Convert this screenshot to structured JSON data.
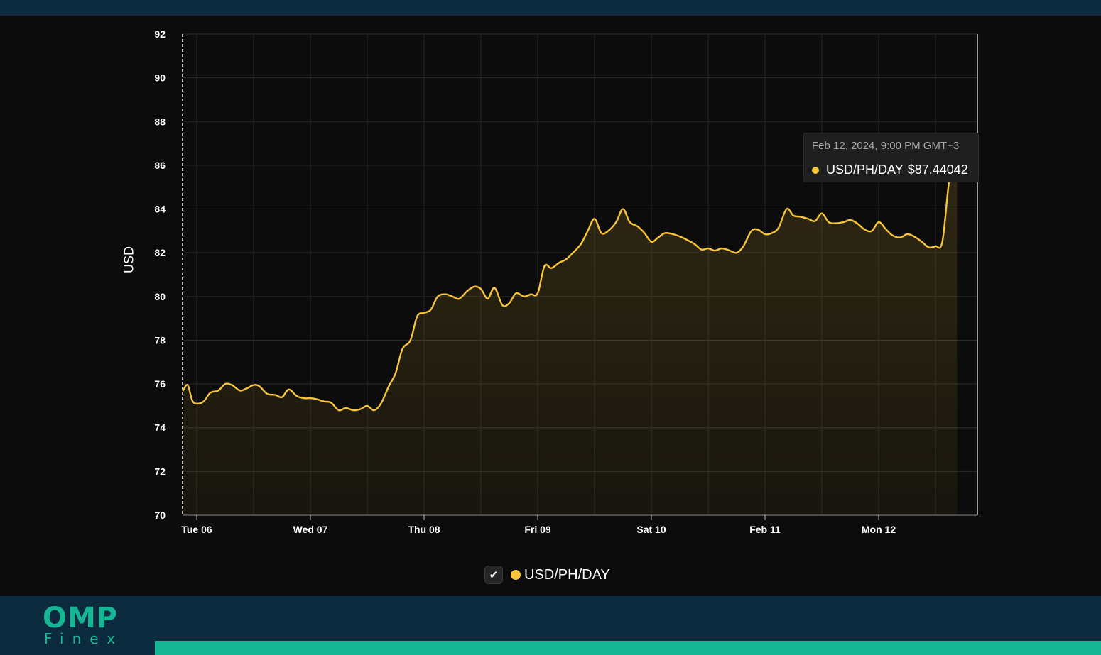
{
  "chart_data": {
    "type": "area",
    "ylabel": "USD",
    "ylim": [
      70,
      92
    ],
    "yticks": [
      70,
      72,
      74,
      76,
      78,
      80,
      82,
      84,
      86,
      88,
      90,
      92
    ],
    "xticks": [
      "Tue 06",
      "Wed 07",
      "Thu 08",
      "Fri 09",
      "Sat 10",
      "Feb 11",
      "Mon 12"
    ],
    "x_unit": "days since Tue 06 00:00",
    "grid": true,
    "legend_position": "bottom-center",
    "series": [
      {
        "name": "USD/PH/DAY",
        "color": "#f7c43a",
        "points": [
          [
            -0.12,
            75.7
          ],
          [
            -0.08,
            75.95
          ],
          [
            -0.04,
            75.25
          ],
          [
            0.0,
            75.1
          ],
          [
            0.06,
            75.2
          ],
          [
            0.12,
            75.6
          ],
          [
            0.19,
            75.7
          ],
          [
            0.25,
            76.0
          ],
          [
            0.31,
            75.95
          ],
          [
            0.38,
            75.7
          ],
          [
            0.44,
            75.8
          ],
          [
            0.5,
            75.95
          ],
          [
            0.55,
            75.9
          ],
          [
            0.62,
            75.55
          ],
          [
            0.69,
            75.5
          ],
          [
            0.75,
            75.4
          ],
          [
            0.81,
            75.75
          ],
          [
            0.88,
            75.45
          ],
          [
            0.94,
            75.35
          ],
          [
            1.0,
            75.35
          ],
          [
            1.06,
            75.3
          ],
          [
            1.12,
            75.2
          ],
          [
            1.18,
            75.15
          ],
          [
            1.25,
            74.8
          ],
          [
            1.31,
            74.9
          ],
          [
            1.38,
            74.8
          ],
          [
            1.44,
            74.85
          ],
          [
            1.5,
            75.0
          ],
          [
            1.56,
            74.8
          ],
          [
            1.62,
            75.1
          ],
          [
            1.69,
            75.9
          ],
          [
            1.75,
            76.5
          ],
          [
            1.81,
            77.6
          ],
          [
            1.88,
            78.0
          ],
          [
            1.94,
            79.1
          ],
          [
            2.0,
            79.25
          ],
          [
            2.06,
            79.4
          ],
          [
            2.12,
            80.0
          ],
          [
            2.19,
            80.1
          ],
          [
            2.25,
            80.0
          ],
          [
            2.31,
            79.9
          ],
          [
            2.38,
            80.25
          ],
          [
            2.44,
            80.45
          ],
          [
            2.5,
            80.35
          ],
          [
            2.56,
            79.9
          ],
          [
            2.62,
            80.4
          ],
          [
            2.69,
            79.6
          ],
          [
            2.75,
            79.7
          ],
          [
            2.81,
            80.15
          ],
          [
            2.88,
            80.0
          ],
          [
            2.94,
            80.1
          ],
          [
            3.0,
            80.15
          ],
          [
            3.06,
            81.4
          ],
          [
            3.12,
            81.3
          ],
          [
            3.19,
            81.55
          ],
          [
            3.25,
            81.7
          ],
          [
            3.31,
            82.0
          ],
          [
            3.38,
            82.4
          ],
          [
            3.44,
            83.0
          ],
          [
            3.5,
            83.55
          ],
          [
            3.56,
            82.9
          ],
          [
            3.62,
            83.0
          ],
          [
            3.69,
            83.4
          ],
          [
            3.75,
            84.0
          ],
          [
            3.81,
            83.4
          ],
          [
            3.88,
            83.2
          ],
          [
            3.94,
            82.9
          ],
          [
            4.0,
            82.5
          ],
          [
            4.06,
            82.7
          ],
          [
            4.12,
            82.9
          ],
          [
            4.19,
            82.85
          ],
          [
            4.25,
            82.75
          ],
          [
            4.31,
            82.6
          ],
          [
            4.38,
            82.4
          ],
          [
            4.44,
            82.15
          ],
          [
            4.5,
            82.2
          ],
          [
            4.56,
            82.1
          ],
          [
            4.62,
            82.2
          ],
          [
            4.69,
            82.1
          ],
          [
            4.75,
            82.0
          ],
          [
            4.81,
            82.3
          ],
          [
            4.88,
            83.0
          ],
          [
            4.94,
            83.05
          ],
          [
            5.0,
            82.85
          ],
          [
            5.06,
            82.9
          ],
          [
            5.12,
            83.15
          ],
          [
            5.19,
            84.0
          ],
          [
            5.25,
            83.7
          ],
          [
            5.31,
            83.65
          ],
          [
            5.38,
            83.55
          ],
          [
            5.44,
            83.45
          ],
          [
            5.5,
            83.8
          ],
          [
            5.56,
            83.4
          ],
          [
            5.62,
            83.35
          ],
          [
            5.69,
            83.4
          ],
          [
            5.75,
            83.5
          ],
          [
            5.81,
            83.35
          ],
          [
            5.88,
            83.05
          ],
          [
            5.94,
            83.0
          ],
          [
            6.0,
            83.4
          ],
          [
            6.06,
            83.1
          ],
          [
            6.12,
            82.8
          ],
          [
            6.19,
            82.7
          ],
          [
            6.25,
            82.85
          ],
          [
            6.31,
            82.75
          ],
          [
            6.38,
            82.5
          ],
          [
            6.44,
            82.25
          ],
          [
            6.5,
            82.3
          ],
          [
            6.56,
            82.5
          ],
          [
            6.62,
            85.3
          ],
          [
            6.69,
            87.44
          ]
        ]
      }
    ]
  },
  "tooltip": {
    "date": "Feb 12, 2024, 9:00 PM GMT+3",
    "series": "USD/PH/DAY",
    "value": "$87.44042"
  },
  "legend": {
    "check_icon": "✔",
    "label": "USD/PH/DAY",
    "checked": true
  },
  "branding": {
    "logo_main": "OMP",
    "logo_sub": "Finex",
    "accent_color": "#16b694"
  }
}
